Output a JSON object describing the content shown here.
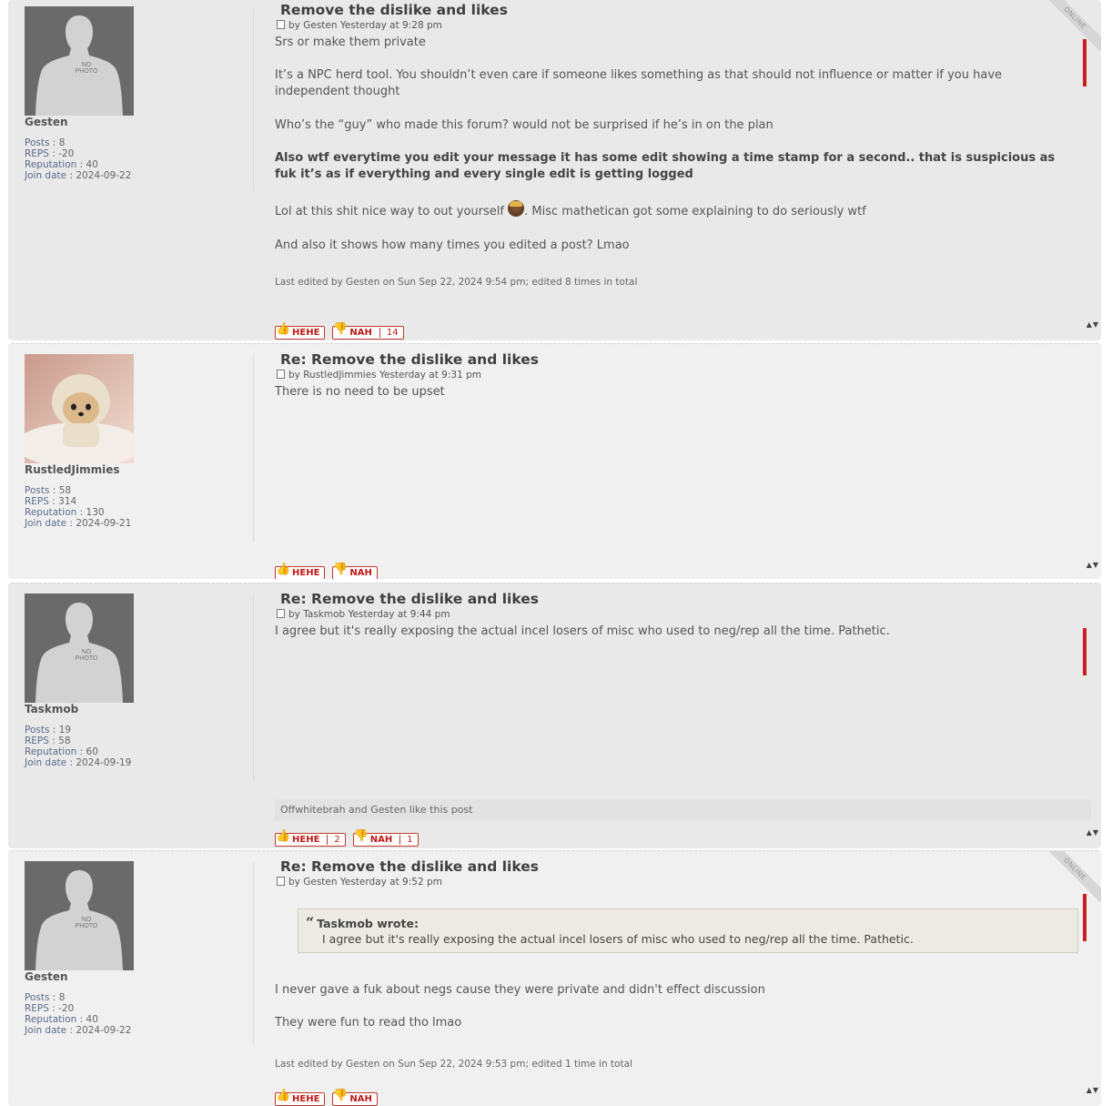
{
  "reactions": {
    "like_label": "HEHE",
    "dislike_label": "NAH"
  },
  "online_label": "ONLINE",
  "no_photo": [
    "NO",
    "PHOTO"
  ],
  "posts": [
    {
      "title": "Remove the dislike and likes",
      "byline": "by Gesten Yesterday at 9:28 pm",
      "user": {
        "name": "Gesten",
        "posts": "8",
        "reps": "-20",
        "reputation": "40",
        "join_date": "2024-09-22"
      },
      "content": [
        "Srs or make them private",
        "It’s a NPC herd tool. You shouldn’t even care if someone likes something as that should not influence or matter if you have independent thought",
        "Who’s the “guy” who made this forum? would not be surprised if he’s in on the plan",
        "Also wtf everytime you edit your message it has some edit showing a time stamp for a second.. that is suspicious as fuk it’s as if everything and every single edit is getting logged",
        "Lol at this shit nice way to out yourself",
        ". Misc mathetican got some explaining to do seriously wtf",
        "And also it shows how many times you edited a post? Lmao"
      ],
      "edit_note": "Last edited by Gesten on Sun Sep 22, 2024 9:54 pm; edited 8 times in total",
      "like_count": "",
      "dislike_count": "14"
    },
    {
      "title": "Re: Remove the dislike and likes",
      "byline": "by RustledJimmies Yesterday at 9:31 pm",
      "user": {
        "name": "RustledJimmies",
        "posts": "58",
        "reps": "314",
        "reputation": "130",
        "join_date": "2024-09-21"
      },
      "content": [
        "There is no need to be upset"
      ],
      "like_count": "",
      "dislike_count": ""
    },
    {
      "title": "Re: Remove the dislike and likes",
      "byline": "by Taskmob Yesterday at 9:44 pm",
      "user": {
        "name": "Taskmob",
        "posts": "19",
        "reps": "58",
        "reputation": "60",
        "join_date": "2024-09-19"
      },
      "content": [
        "I agree but it's really exposing the actual incel losers of misc who used to neg/rep all the time. Pathetic."
      ],
      "likes_text": "Offwhitebrah and Gesten like this post",
      "like_count": "2",
      "dislike_count": "1"
    },
    {
      "title": "Re: Remove the dislike and likes",
      "byline": "by Gesten Yesterday at 9:52 pm",
      "user": {
        "name": "Gesten",
        "posts": "8",
        "reps": "-20",
        "reputation": "40",
        "join_date": "2024-09-22"
      },
      "quote": {
        "author": "Taskmob wrote:",
        "text": "I agree but it's really exposing the actual incel losers of misc who used to neg/rep all the time. Pathetic."
      },
      "content": [
        "I never gave a fuk about negs cause they were private and didn't effect discussion",
        "They were fun to read tho lmao"
      ],
      "edit_note": "Last edited by Gesten on Sun Sep 22, 2024 9:53 pm; edited 1 time in total"
    }
  ],
  "labels": {
    "posts": "Posts",
    "reps": "REPS",
    "reputation": "Reputation",
    "join_date": "Join date",
    "sep": ":"
  }
}
